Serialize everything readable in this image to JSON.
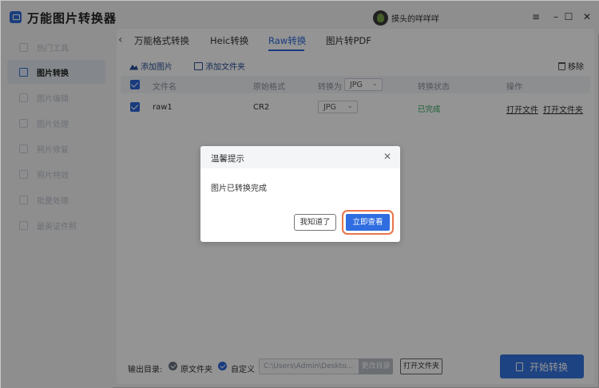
{
  "app": {
    "title": "万能图片转换器"
  },
  "user": {
    "name": "摸头的咩咩咩"
  },
  "window_controls": {
    "menu": "≡",
    "minimize": "–",
    "maximize": "☐",
    "close": "✕"
  },
  "sidebar": {
    "items": [
      {
        "label": "热门工具",
        "icon": "fire-icon"
      },
      {
        "label": "图片转换",
        "icon": "image-convert-icon",
        "active": true
      },
      {
        "label": "图片编辑",
        "icon": "edit-icon"
      },
      {
        "label": "图片处理",
        "icon": "process-icon"
      },
      {
        "label": "照片修复",
        "icon": "repair-icon"
      },
      {
        "label": "照片特效",
        "icon": "effect-icon"
      },
      {
        "label": "批量处理",
        "icon": "batch-icon"
      },
      {
        "label": "最美证件照",
        "icon": "id-photo-icon"
      }
    ]
  },
  "tabs": [
    {
      "label": "万能格式转换"
    },
    {
      "label": "Heic转换"
    },
    {
      "label": "Raw转换",
      "active": true
    },
    {
      "label": "图片转PDF"
    }
  ],
  "toolbar": {
    "add_image": "添加图片",
    "add_folder": "添加文件夹",
    "remove": "移除"
  },
  "table": {
    "headers": {
      "filename": "文件名",
      "original_format": "原始格式",
      "convert_to": "转换为",
      "convert_to_value": "JPG",
      "status": "转换状态",
      "actions": "操作"
    },
    "rows": [
      {
        "filename": "raw1",
        "original_format": "CR2",
        "target_format": "JPG",
        "status": "已完成",
        "open_file": "打开文件",
        "open_folder": "打开文件夹"
      }
    ]
  },
  "bottom": {
    "output_label": "输出目录:",
    "option_original": "原文件夹",
    "option_custom": "自定义",
    "path": "C:\\Users\\Admin\\Deskto...",
    "change_dir": "更改目录",
    "open_folder": "打开文件夹",
    "start": "开始转换"
  },
  "dialog": {
    "title": "温馨提示",
    "message": "图片已转换完成",
    "btn_ok": "我知道了",
    "btn_view": "立即查看",
    "highlight_color": "#e8754a"
  },
  "colors": {
    "accent": "#2b66d9",
    "success": "#2da55a"
  }
}
